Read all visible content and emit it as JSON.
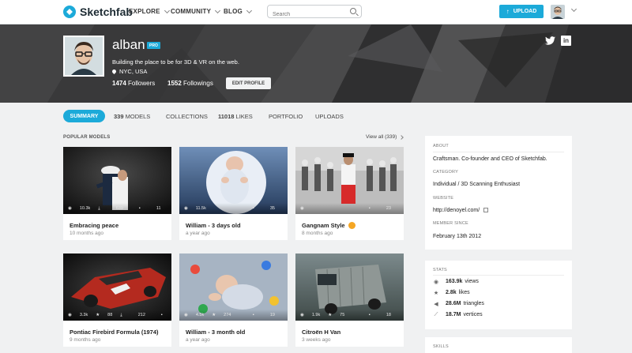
{
  "nav": {
    "brand": "Sketchfab",
    "items": [
      "EXPLORE",
      "COMMUNITY",
      "BLOG"
    ],
    "search_placeholder": "Search",
    "upload_label": "UPLOAD"
  },
  "profile": {
    "username": "alban",
    "badge": "PRO",
    "tagline": "Building the place to be for 3D & VR on the web.",
    "location": "NYC, USA",
    "followers_count": "1474",
    "followers_label": "Followers",
    "followings_count": "1552",
    "followings_label": "Followings",
    "edit_label": "EDIT PROFILE"
  },
  "tabs": [
    {
      "count": "",
      "label": "SUMMARY"
    },
    {
      "count": "339",
      "label": "MODELS"
    },
    {
      "count": "",
      "label": "COLLECTIONS"
    },
    {
      "count": "11018",
      "label": "LIKES"
    },
    {
      "count": "",
      "label": "PORTFOLIO"
    },
    {
      "count": "",
      "label": "UPLOADS"
    }
  ],
  "popular": {
    "label": "POPULAR MODELS",
    "view_all": "View all (339)",
    "models": [
      {
        "title": "Embracing peace",
        "time": "10 months ago",
        "views": "10.3k",
        "likes": "",
        "downloads": "639",
        "comments": "11"
      },
      {
        "title": "William - 3 days old",
        "time": "a year ago",
        "views": "11.5k",
        "likes": "",
        "downloads": "",
        "comments": "35"
      },
      {
        "title": "Gangnam Style",
        "time": "8 months ago",
        "views": "",
        "likes": "",
        "downloads": "",
        "comments": "23",
        "staff_pick": true
      },
      {
        "title": "Pontiac Firebird Formula (1974)",
        "time": "9 months ago",
        "views": "3.3k",
        "likes": "88",
        "downloads": "212",
        "comments": "11"
      },
      {
        "title": "William - 3 month old",
        "time": "a year ago",
        "views": "4.5k",
        "likes": "274",
        "downloads": "",
        "comments": "19"
      },
      {
        "title": "Citroën H Van",
        "time": "3 weeks ago",
        "views": "1.9k",
        "likes": "75",
        "downloads": "",
        "comments": "18"
      }
    ]
  },
  "about": {
    "label": "ABOUT",
    "text": "Craftsman. Co-founder and CEO of Sketchfab.",
    "category_label": "CATEGORY",
    "category": "Individual / 3D Scanning Enthusiast",
    "website_label": "WEBSITE",
    "website": "http://denoyel.com/",
    "member_label": "MEMBER SINCE",
    "member_since": "February 13th 2012"
  },
  "stats": {
    "label": "STATS",
    "rows": [
      {
        "value": "163.9k",
        "label": "views",
        "icon": "eye-icon"
      },
      {
        "value": "2.8k",
        "label": "likes",
        "icon": "star-icon"
      },
      {
        "value": "28.6M",
        "label": "triangles",
        "icon": "triangle-icon"
      },
      {
        "value": "18.7M",
        "label": "vertices",
        "icon": "vertex-icon"
      }
    ]
  },
  "skills": {
    "label": "SKILLS"
  },
  "colors": {
    "accent": "#1caad9",
    "header": "#3c3c3d",
    "page": "#f0f1f2"
  }
}
